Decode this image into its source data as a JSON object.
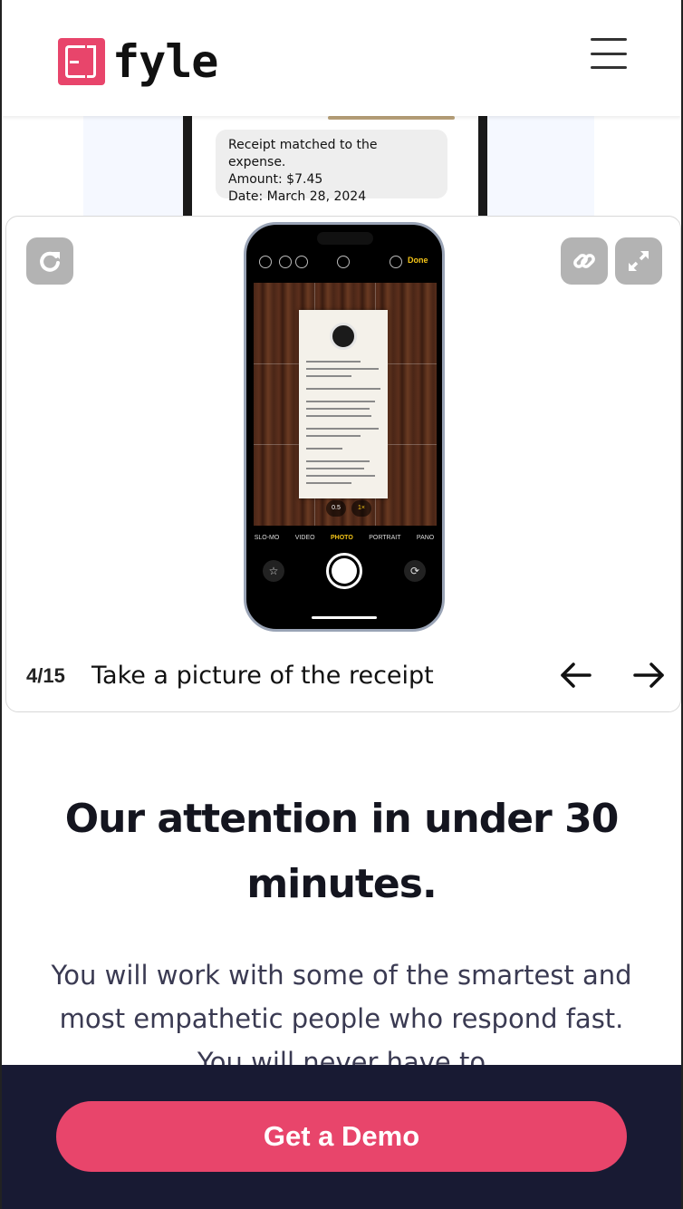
{
  "header": {
    "logo_text": "fyle",
    "brand_color": "#e8456b"
  },
  "background_preview": {
    "bubble_lines": [
      "Receipt matched to the expense.",
      "Amount: $7.45",
      "Date: March 28, 2024"
    ]
  },
  "walkthrough": {
    "counter": "4/15",
    "caption": "Take a picture of the receipt",
    "phone": {
      "done_label": "Done",
      "zoom": [
        "0.5",
        "1×"
      ],
      "modes": [
        "SLO-MO",
        "VIDEO",
        "PHOTO",
        "PORTRAIT",
        "PANO"
      ],
      "active_mode": "PHOTO"
    }
  },
  "section": {
    "heading": "Our attention in under 30 minutes.",
    "body": "You will work with some of the smartest and most empathetic people who respond fast. You will never have to"
  },
  "cta": {
    "label": "Get a Demo",
    "bar_color": "#181a33"
  }
}
